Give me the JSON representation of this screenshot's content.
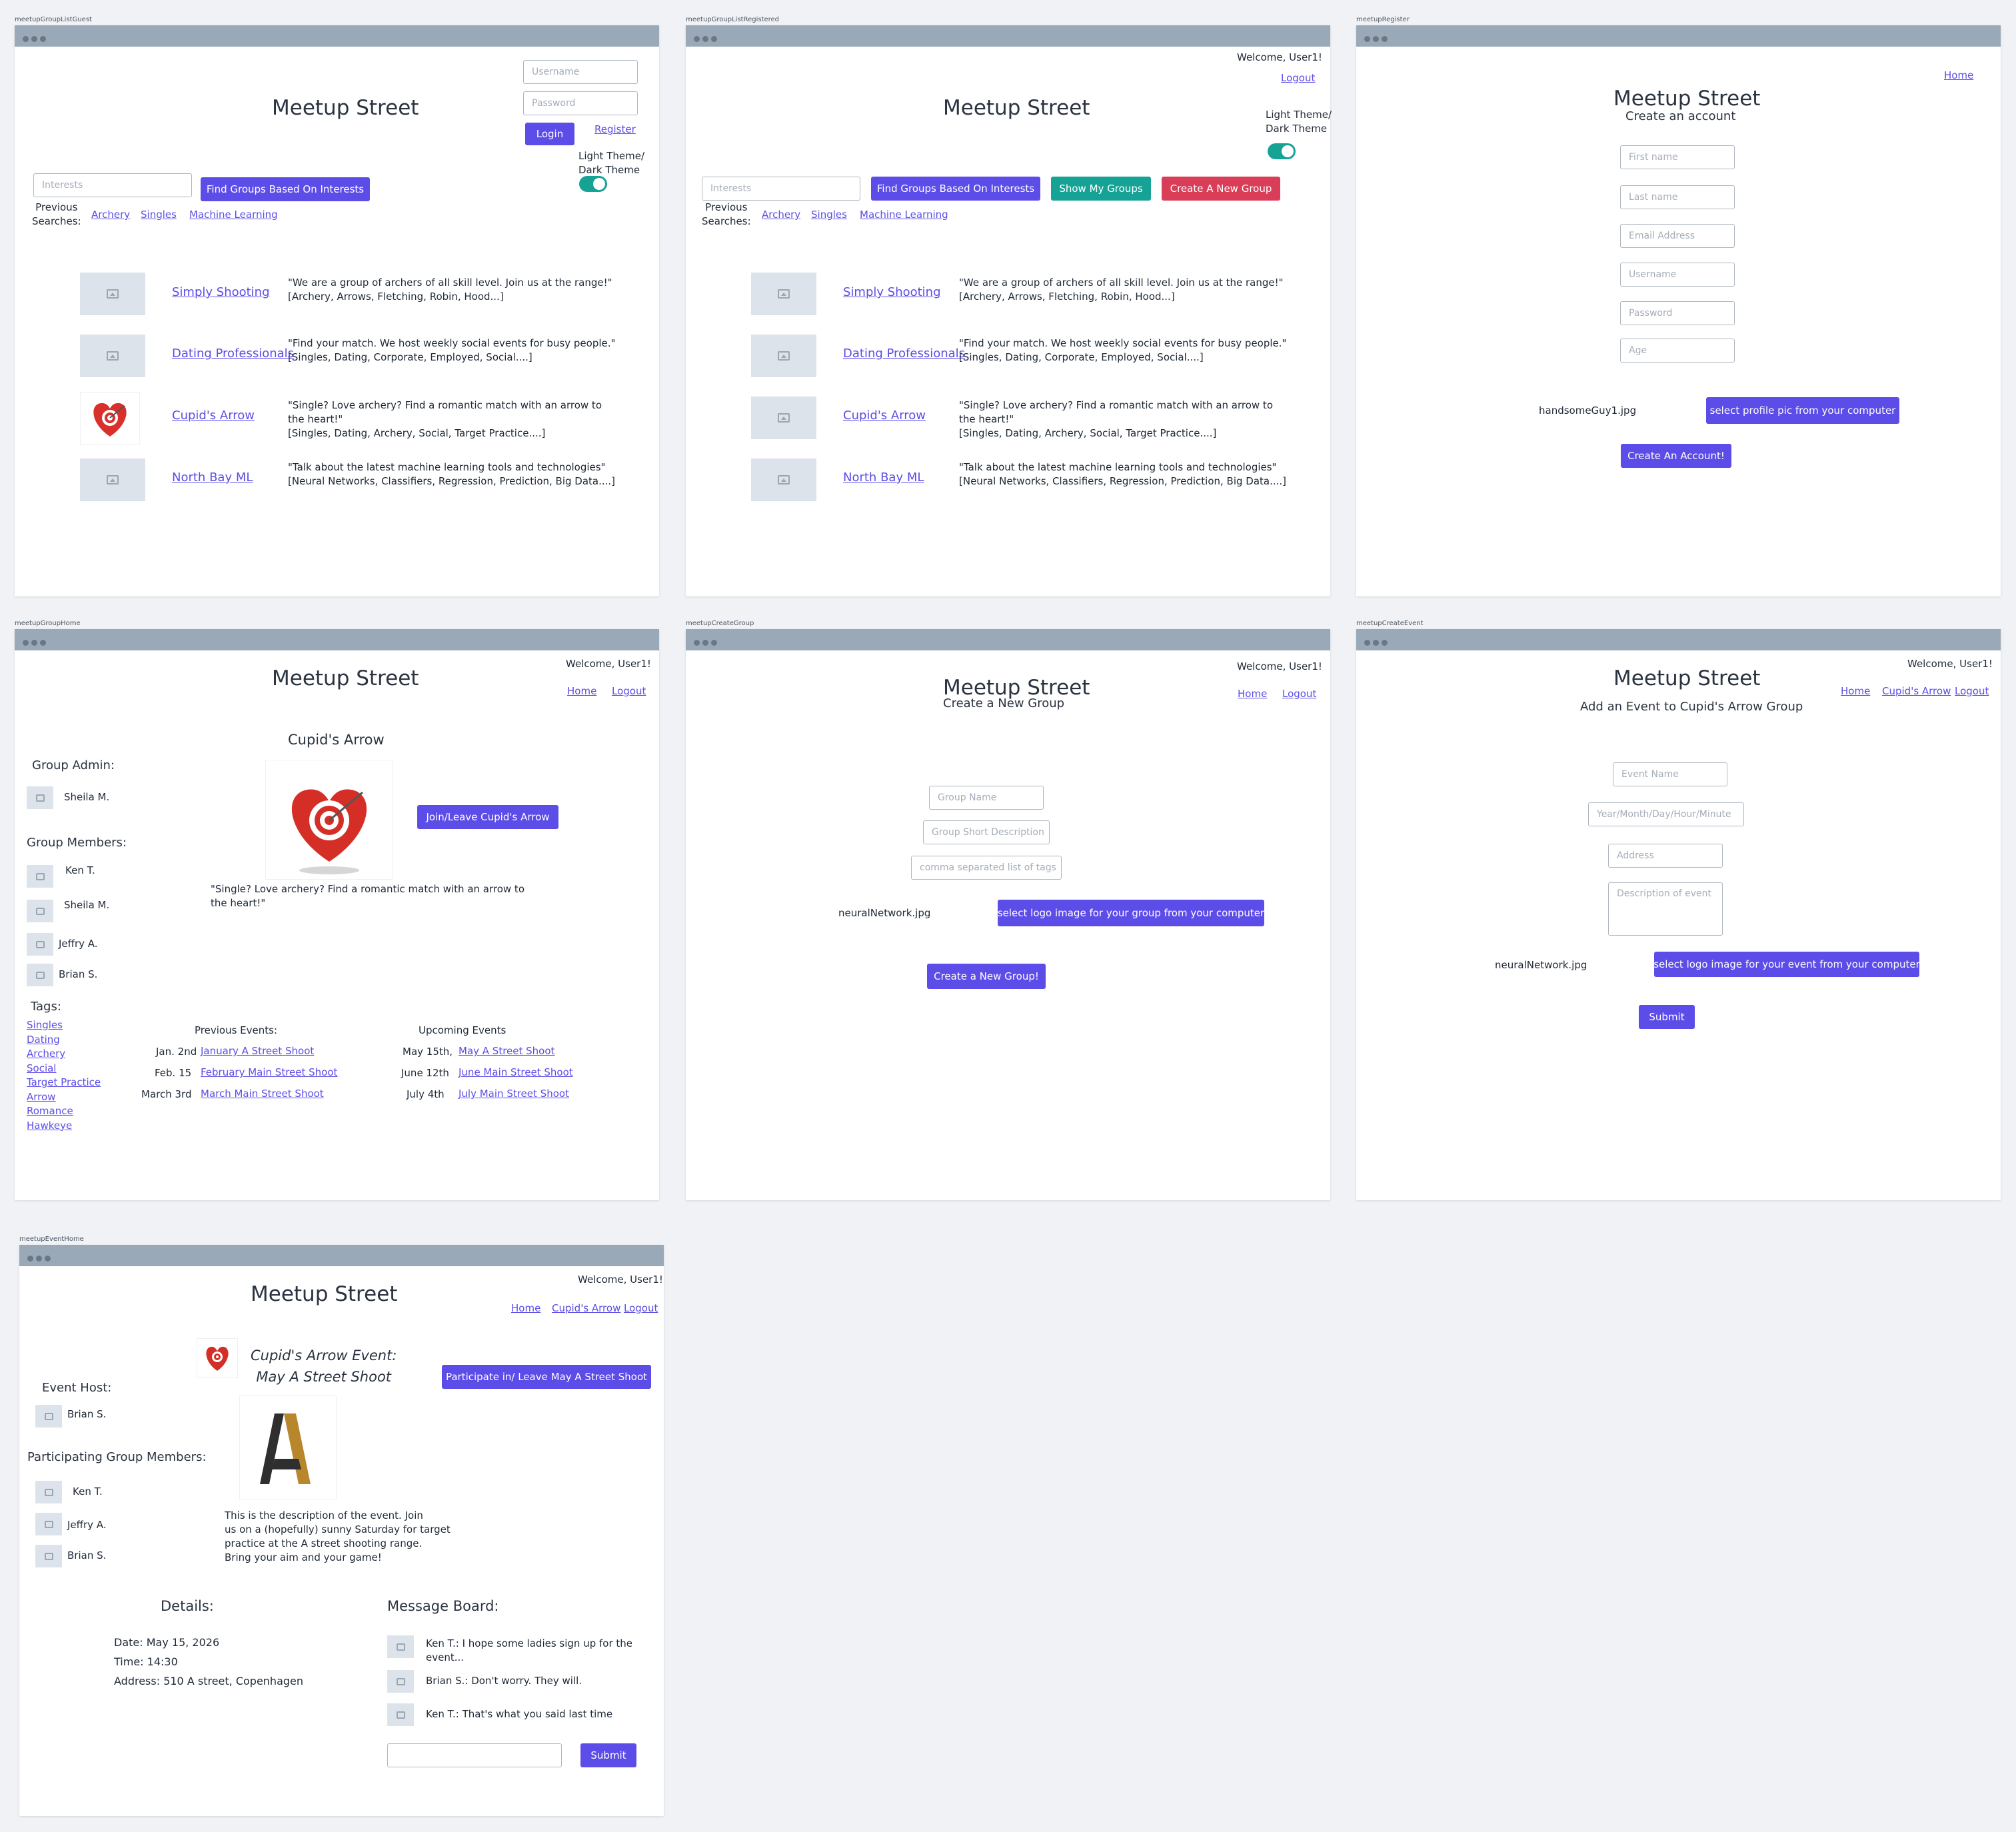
{
  "app_title": "Meetup Street",
  "colors": {
    "primary": "#5c4ce8",
    "teal": "#16a396",
    "danger": "#d93d57",
    "placeholder_bg": "#dde3ea"
  },
  "screen1": {
    "label": "meetupGroupListGuest",
    "title": "Meetup Street",
    "username_placeholder": "Username",
    "password_placeholder": "Password",
    "login": "Login",
    "register": "Register",
    "theme_line1": "Light Theme/",
    "theme_line2": "Dark Theme",
    "interests_placeholder": "Interests",
    "find_button": "Find Groups Based On Interests",
    "prev_line1": "Previous",
    "prev_line2": "Searches:",
    "prev_searches": [
      "Archery",
      "Singles",
      "Machine Learning"
    ]
  },
  "screen2": {
    "label": "meetupGroupListRegistered",
    "title": "Meetup Street",
    "welcome": "Welcome, User1!",
    "logout": "Logout",
    "theme_line1": "Light Theme/",
    "theme_line2": "Dark Theme",
    "interests_placeholder": "Interests",
    "find_button": "Find Groups Based On Interests",
    "show_groups": "Show My Groups",
    "create_group": "Create  A New Group",
    "prev_line1": "Previous",
    "prev_line2": "Searches:",
    "prev_searches": [
      "Archery",
      "Singles",
      "Machine Learning"
    ]
  },
  "groups": [
    {
      "name": "Simply Shooting",
      "desc1": "\"We are a group of archers of all skill level. Join us at the range!\"",
      "desc2": "[Archery, Arrows, Fletching, Robin, Hood...]",
      "desc3": ""
    },
    {
      "name": "Dating Professionals",
      "desc1": "\"Find your match. We host weekly social events for busy people.\"",
      "desc2": "[Singles, Dating, Corporate, Employed, Social....]",
      "desc3": ""
    },
    {
      "name": "Cupid's Arrow",
      "desc1": "\"Single? Love archery? Find a romantic match with an arrow to",
      "desc2": "the heart!\"",
      "desc3": "[Singles, Dating, Archery,  Social, Target Practice....]"
    },
    {
      "name": "North Bay ML",
      "desc1": "\"Talk about the latest machine learning tools and technologies\"",
      "desc2": "[Neural Networks, Classifiers, Regression, Prediction, Big Data....]",
      "desc3": ""
    }
  ],
  "screen3": {
    "label": "meetupRegister",
    "home": "Home",
    "title": "Meetup Street",
    "subtitle": "Create an account",
    "fields": [
      "First name",
      "Last name",
      "Email Address",
      "Username",
      "Password",
      "Age"
    ],
    "file_name": "handsomeGuy1.jpg",
    "select_pic": "select profile pic from your computer",
    "create": "Create An Account!"
  },
  "screen4": {
    "label": "meetupGroupHome",
    "title": "Meetup Street",
    "welcome": "Welcome, User1!",
    "home": "Home",
    "logout": "Logout",
    "group_name": "Cupid's Arrow",
    "admin_heading": "Group Admin:",
    "admin": "Sheila M.",
    "members_heading": "Group Members:",
    "members": [
      "Ken T.",
      "Sheila M.",
      "Jeffry A.",
      "Brian S."
    ],
    "join_button": "Join/Leave Cupid's Arrow",
    "desc1": "\"Single? Love archery? Find a romantic match with an arrow to",
    "desc2": "the heart!\"",
    "tags_heading": "Tags:",
    "tags": [
      "Singles",
      "Dating",
      "Archery",
      "Social",
      "Target Practice",
      "Arrow",
      "Romance",
      "Hawkeye"
    ],
    "prev_heading": "Previous Events:",
    "upcoming_heading": "Upcoming Events",
    "prev_events": [
      {
        "date": "Jan. 2nd",
        "name": "January A Street Shoot"
      },
      {
        "date": "Feb. 15",
        "name": "February Main Street Shoot"
      },
      {
        "date": "March 3rd",
        "name": "March Main Street Shoot"
      }
    ],
    "upcoming_events": [
      {
        "date": "May 15th,",
        "name": "May A Street Shoot"
      },
      {
        "date": "June 12th",
        "name": "June Main Street Shoot"
      },
      {
        "date": "July 4th",
        "name": "July Main Street Shoot"
      }
    ]
  },
  "screen5": {
    "label": "meetupCreateGroup",
    "title": "Meetup Street",
    "subtitle": "Create a New Group",
    "welcome": "Welcome, User1!",
    "home": "Home",
    "logout": "Logout",
    "fields": [
      "Group Name",
      "Group Short Description",
      "comma separated list of tags"
    ],
    "file_name": "neuralNetwork.jpg",
    "select_logo": "select logo image for your group from your computer",
    "create": "Create a New Group!"
  },
  "screen6": {
    "label": "meetupCreateEvent",
    "title": "Meetup Street",
    "subtitle": "Add an Event to Cupid's Arrow Group",
    "welcome": "Welcome, User1!",
    "home": "Home",
    "group_link": "Cupid's Arrow",
    "logout": "Logout",
    "fields": [
      "Event Name",
      "Year/Month/Day/Hour/Minute",
      "Address",
      "Description of event"
    ],
    "file_name": "neuralNetwork.jpg",
    "select_logo": "select logo image for your event from your computer",
    "submit": "Submit"
  },
  "screen7": {
    "label": "meetupEventHome",
    "title": "Meetup Street",
    "welcome": "Welcome, User1!",
    "home": "Home",
    "group_link": "Cupid's Arrow",
    "logout": "Logout",
    "event_title1": "Cupid's Arrow Event:",
    "event_title2": "May A Street Shoot",
    "participate": "Participate in/ Leave May A Street Shoot",
    "host_heading": "Event Host:",
    "host": "Brian S.",
    "participants_heading": "Participating Group Members:",
    "participants": [
      "Ken T.",
      "Jeffry A.",
      "Brian S."
    ],
    "description": [
      "This is the description of the event. Join",
      "us on a (hopefully) sunny Saturday for target",
      "practice at the A street shooting range.",
      "Bring your aim and your game!"
    ],
    "details_heading": "Details:",
    "details": [
      "Date: May 15, 2026",
      "Time: 14:30",
      "Address: 510 A street, Copenhagen"
    ],
    "board_heading": "Message Board:",
    "messages": [
      "Ken T.: I hope some ladies sign up for the",
      "event...",
      "Brian S.: Don't worry. They will.",
      "Ken T.: That's what you said last time"
    ],
    "submit": "Submit"
  }
}
